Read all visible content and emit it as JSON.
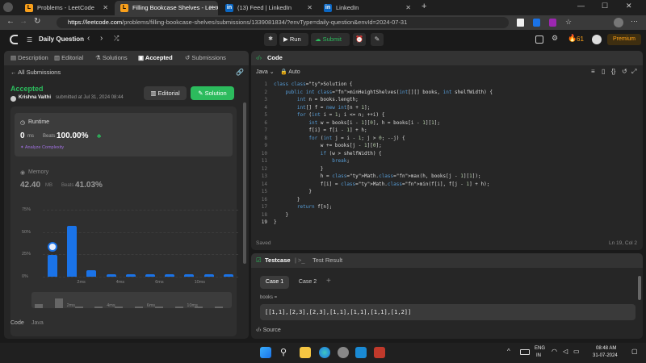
{
  "browser": {
    "tabs": [
      {
        "label": "Problems - LeetCode"
      },
      {
        "label": "Filling Bookcase Shelves - LeetCo"
      },
      {
        "label": "(13) Feed | LinkedIn"
      },
      {
        "label": "LinkedIn"
      }
    ],
    "url_host": "https://leetcode.com",
    "url_path": "/problems/filling-bookcase-shelves/submissions/1339081834/?envType=daily-question&envId=2024-07-31"
  },
  "nav": {
    "title": "Daily Question",
    "run": "Run",
    "submit": "Submit",
    "streak": "61",
    "premium": "Premium"
  },
  "left_tabs": [
    "Description",
    "Editorial",
    "Solutions",
    "Accepted",
    "Submissions"
  ],
  "submission": {
    "back": "All Submissions",
    "status": "Accepted",
    "user": "Krishna Vaithi",
    "submitted": "submitted at Jul 31, 2024 08:44",
    "editorial_btn": "Editorial",
    "solution_btn": "Solution",
    "runtime_label": "Runtime",
    "runtime_value": "0",
    "runtime_unit": "ms",
    "beats_label": "Beats",
    "runtime_beats": "100.00%",
    "analyze": "Analyze Complexity",
    "memory_label": "Memory",
    "memory_value": "42.40",
    "memory_unit": "MB",
    "memory_beats": "41.03%",
    "code_label": "Code",
    "code_lang": "Java"
  },
  "chart_data": {
    "type": "bar",
    "ylabels": [
      "75%",
      "50%",
      "25%",
      "0%"
    ],
    "xlabels": [
      "2ms",
      "4ms",
      "6ms",
      "10ms"
    ],
    "values": [
      24,
      57,
      7,
      3,
      3,
      3,
      3,
      3,
      3,
      3
    ],
    "highlight_index": 0,
    "ylim": [
      0,
      75
    ]
  },
  "editor": {
    "title": "Code",
    "lang": "Java",
    "mode": "Auto",
    "saved": "Saved",
    "position": "Ln 19, Col 2",
    "lines": [
      "class Solution {",
      "    public int minHeightShelves(int[][] books, int shelfWidth) {",
      "        int n = books.length;",
      "        int[] f = new int[n + 1];",
      "        for (int i = 1; i <= n; ++i) {",
      "            int w = books[i - 1][0], h = books[i - 1][1];",
      "            f[i] = f[i - 1] + h;",
      "            for (int j = i - 1; j > 0; --j) {",
      "                w += books[j - 1][0];",
      "                if (w > shelfWidth) {",
      "                    break;",
      "                }",
      "                h = Math.max(h, books[j - 1][1]);",
      "                f[i] = Math.min(f[i], f[j - 1] + h);",
      "            }",
      "        }",
      "        return f[n];",
      "    }",
      "}"
    ]
  },
  "testcase": {
    "tab": "Testcase",
    "result_tab": "Test Result",
    "cases": [
      "Case 1",
      "Case 2"
    ],
    "field": "books =",
    "value": "[[1,1],[2,3],[2,3],[1,1],[1,1],[1,1],[1,2]]",
    "source": "Source"
  },
  "taskbar": {
    "lang1": "ENG",
    "lang2": "IN",
    "time": "08:48 AM",
    "date": "31-07-2024"
  }
}
